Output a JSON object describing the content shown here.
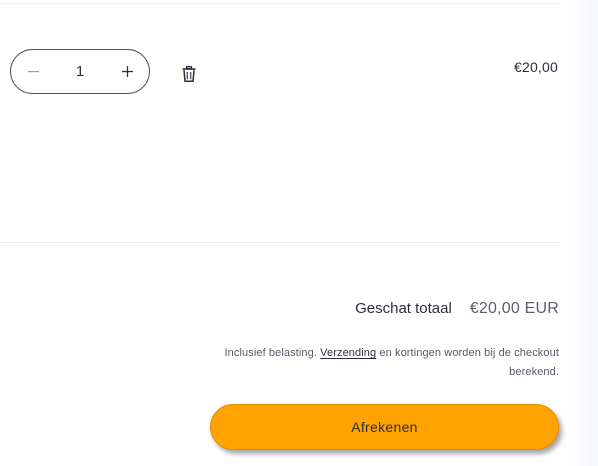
{
  "cart_item": {
    "quantity_value": "1",
    "decrease_symbol": "−",
    "increase_symbol": "+",
    "price": "€20,00"
  },
  "summary": {
    "estimated_total_label": "Geschat totaal",
    "estimated_total_value": "€20,00 EUR",
    "tax_note_before": "Inclusief belasting. ",
    "shipping_link": "Verzending",
    "tax_note_after": " en kortingen worden bij de checkout berekend."
  },
  "checkout": {
    "button_label": "Afrekenen"
  },
  "colors": {
    "accent": "#ffa300",
    "text": "#2b2f3a",
    "divider": "#eceef1"
  }
}
